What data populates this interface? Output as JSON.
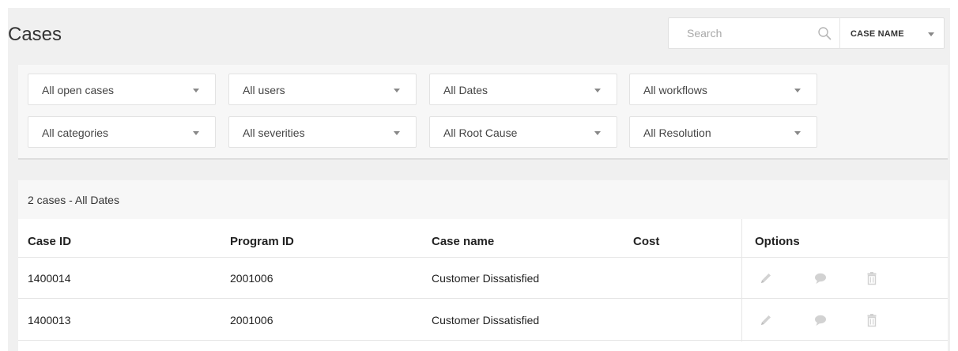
{
  "page": {
    "title": "Cases"
  },
  "search": {
    "placeholder": "Search",
    "value": ""
  },
  "search_field": {
    "label": "CASE NAME"
  },
  "filters": [
    {
      "label": "All open cases"
    },
    {
      "label": "All users"
    },
    {
      "label": "All Dates"
    },
    {
      "label": "All workflows"
    },
    {
      "label": "All categories"
    },
    {
      "label": "All severities"
    },
    {
      "label": "All Root Cause"
    },
    {
      "label": "All Resolution"
    }
  ],
  "results": {
    "summary": "2 cases - All Dates"
  },
  "table": {
    "columns": [
      "Case ID",
      "Program ID",
      "Case name",
      "Cost",
      "Options"
    ],
    "rows": [
      {
        "case_id": "1400014",
        "program_id": "2001006",
        "case_name": "Customer Dissatisfied",
        "cost": ""
      },
      {
        "case_id": "1400013",
        "program_id": "2001006",
        "case_name": "Customer Dissatisfied",
        "cost": ""
      }
    ]
  },
  "icons": {
    "search": "search-icon",
    "dropdown": "chevron-down-icon",
    "edit": "pencil-icon",
    "comment": "comment-icon",
    "delete": "trash-icon"
  },
  "colors": {
    "page_bg": "#f0f0f0",
    "panel_bg": "#f7f7f7",
    "icon_gray": "#cccccc",
    "text": "#222222"
  }
}
